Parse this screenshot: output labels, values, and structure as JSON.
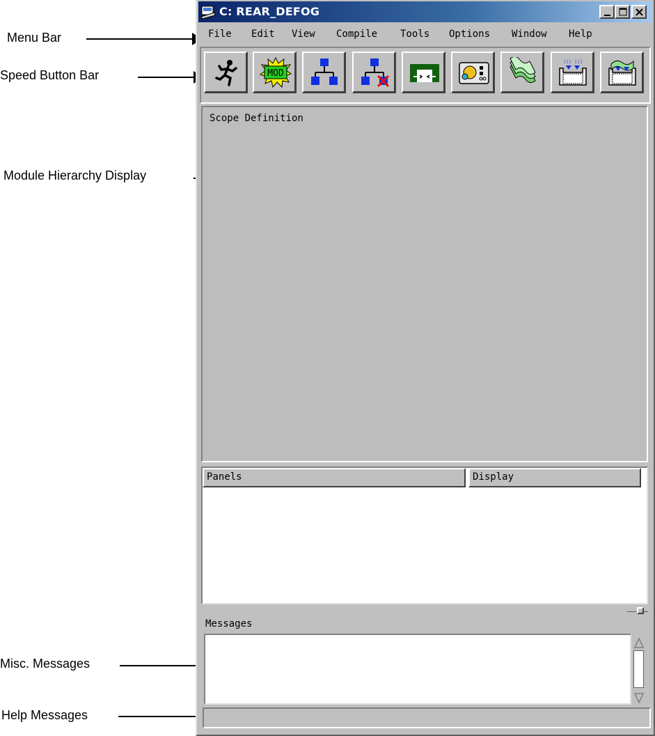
{
  "annotations": {
    "menu_bar": "Menu Bar",
    "speed_button_bar": "Speed Button Bar",
    "module_hierarchy_display": "Module Hierarchy Display",
    "misc_messages": "Misc. Messages",
    "help_messages": "Help Messages"
  },
  "window": {
    "title": "C: REAR_DEFOG",
    "title_icon": "app-icon"
  },
  "title_buttons": [
    "minimize-icon",
    "maximize-icon",
    "close-icon"
  ],
  "menu": {
    "items": [
      "File",
      "Edit",
      "View",
      "Compile",
      "Tools",
      "Options",
      "Window",
      "Help"
    ]
  },
  "speed_buttons": [
    {
      "icon": "runner-icon"
    },
    {
      "icon": "mod-burst-icon",
      "text": "MOD"
    },
    {
      "icon": "hierarchy-icon"
    },
    {
      "icon": "hierarchy-delete-icon"
    },
    {
      "icon": "panel-connect-icon"
    },
    {
      "icon": "instrument-icon"
    },
    {
      "icon": "pages-icon"
    },
    {
      "icon": "import-icon"
    },
    {
      "icon": "export-icon"
    }
  ],
  "hierarchy": {
    "label": "Scope Definition"
  },
  "panels_table": {
    "columns": [
      "Panels",
      "Display"
    ]
  },
  "messages": {
    "label": "Messages"
  }
}
